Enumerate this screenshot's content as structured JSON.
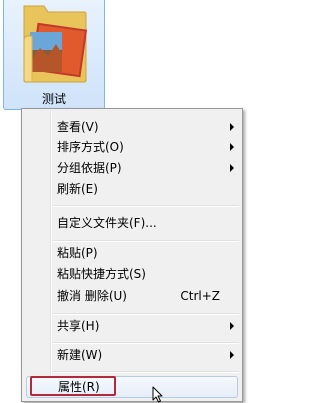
{
  "folder": {
    "name": "测试",
    "icon": "folder-icon"
  },
  "menu": {
    "items": [
      {
        "label": "查看(V)",
        "submenu": true
      },
      {
        "label": "排序方式(O)",
        "submenu": true
      },
      {
        "label": "分组依据(P)",
        "submenu": true
      },
      {
        "label": "刷新(E)",
        "submenu": false
      },
      {
        "label": "自定义文件夹(F)...",
        "submenu": false
      },
      {
        "label": "粘贴(P)",
        "submenu": false
      },
      {
        "label": "粘贴快捷方式(S)",
        "submenu": false
      },
      {
        "label": "撤消 删除(U)",
        "shortcut": "Ctrl+Z",
        "submenu": false
      },
      {
        "label": "共享(H)",
        "submenu": true
      },
      {
        "label": "新建(W)",
        "submenu": true
      },
      {
        "label": "属性(R)",
        "submenu": false
      }
    ]
  },
  "colors": {
    "highlight_box": "#b02a3a",
    "menu_bg": "#f0f0f0",
    "selection": "#cfe3fa"
  }
}
